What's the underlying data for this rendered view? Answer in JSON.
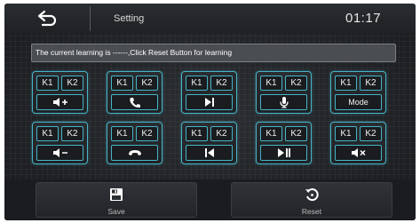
{
  "header": {
    "back_icon": "back-arrow-icon",
    "title": "Setting",
    "time": "01:17"
  },
  "status": {
    "message": "The current learning is ------,Click Reset Button for learning"
  },
  "keys": [
    {
      "k1": "K1",
      "k2": "K2",
      "function": "volume-up",
      "icon": "volume-up-icon",
      "label": ""
    },
    {
      "k1": "K1",
      "k2": "K2",
      "function": "call-answer",
      "icon": "phone-icon",
      "label": ""
    },
    {
      "k1": "K1",
      "k2": "K2",
      "function": "next-track",
      "icon": "next-track-icon",
      "label": ""
    },
    {
      "k1": "K1",
      "k2": "K2",
      "function": "voice",
      "icon": "microphone-icon",
      "label": ""
    },
    {
      "k1": "K1",
      "k2": "K2",
      "function": "mode",
      "icon": "",
      "label": "Mode"
    },
    {
      "k1": "K1",
      "k2": "K2",
      "function": "volume-down",
      "icon": "volume-down-icon",
      "label": ""
    },
    {
      "k1": "K1",
      "k2": "K2",
      "function": "call-hangup",
      "icon": "hang-up-icon",
      "label": ""
    },
    {
      "k1": "K1",
      "k2": "K2",
      "function": "previous-track",
      "icon": "previous-track-icon",
      "label": ""
    },
    {
      "k1": "K1",
      "k2": "K2",
      "function": "play-pause",
      "icon": "play-pause-icon",
      "label": ""
    },
    {
      "k1": "K1",
      "k2": "K2",
      "function": "mute",
      "icon": "mute-icon",
      "label": ""
    }
  ],
  "actions": {
    "save_label": "Save",
    "save_icon": "save-icon",
    "reset_label": "Reset",
    "reset_icon": "reset-icon"
  },
  "colors": {
    "accent": "#46b4c7",
    "background": "#1e2023",
    "status_bar": "#4a4e53",
    "text": "#ffffff"
  }
}
